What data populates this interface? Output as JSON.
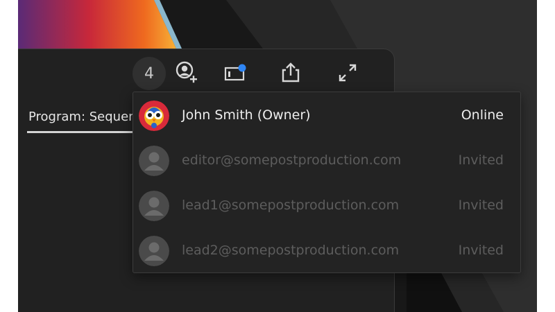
{
  "colors": {
    "panel_bg": "#212121",
    "dropdown_bg": "#232323",
    "primary_text": "#ededed",
    "muted_text": "#5d5d5d",
    "notification_dot": "#2f86f5",
    "wallpaper_gradient": [
      "#5a2a76",
      "#c8283a",
      "#ef6a1f",
      "#f6b037"
    ]
  },
  "toolbar": {
    "collaborator_count": "4",
    "icons": [
      "add-user-icon",
      "notification-panel-icon",
      "share-icon",
      "fullscreen-icon"
    ]
  },
  "program_tab": {
    "label": "Program: Sequence"
  },
  "collaborators": [
    {
      "name": "John Smith (Owner)",
      "status": "Online",
      "avatar": "owl-avatar-icon"
    },
    {
      "name": "editor@somepostproduction.com",
      "status": "Invited",
      "avatar": "default-user-avatar-icon"
    },
    {
      "name": "lead1@somepostproduction.com",
      "status": "Invited",
      "avatar": "default-user-avatar-icon"
    },
    {
      "name": "lead2@somepostproduction.com",
      "status": "Invited",
      "avatar": "default-user-avatar-icon"
    }
  ]
}
